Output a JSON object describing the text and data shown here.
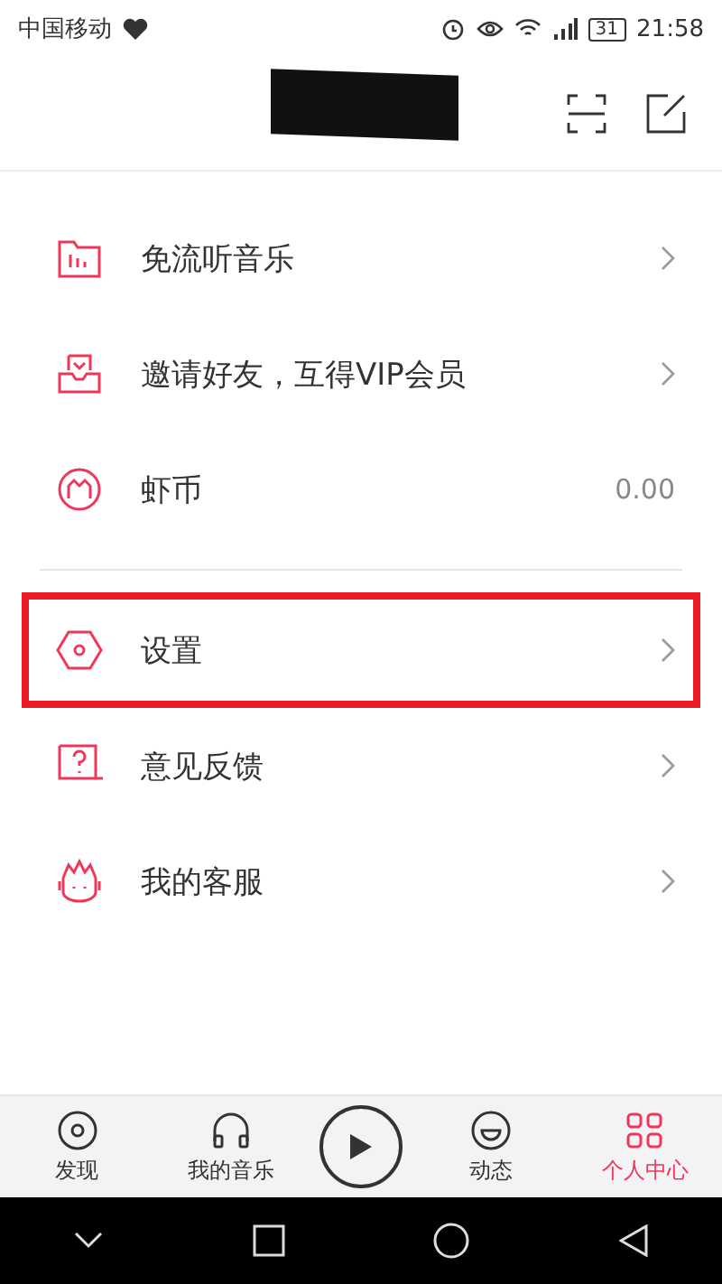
{
  "status_bar": {
    "carrier": "中国移动",
    "battery": "31",
    "time": "21:58"
  },
  "header": {
    "redacted": true
  },
  "groups": [
    {
      "items": [
        {
          "label": "免流听音乐",
          "highlighted": false
        },
        {
          "label": "邀请好友，互得VIP会员",
          "highlighted": false
        },
        {
          "label": "虾币",
          "value": "0.00",
          "highlighted": false
        }
      ]
    },
    {
      "items": [
        {
          "label": "设置",
          "highlighted": true
        },
        {
          "label": "意见反馈",
          "highlighted": false
        },
        {
          "label": "我的客服",
          "highlighted": false
        }
      ]
    }
  ],
  "tab_bar": [
    {
      "label": "发现",
      "selected": false
    },
    {
      "label": "我的音乐",
      "selected": false
    },
    {
      "label": "动态",
      "selected": false
    },
    {
      "label": "个人中心",
      "selected": true
    }
  ]
}
